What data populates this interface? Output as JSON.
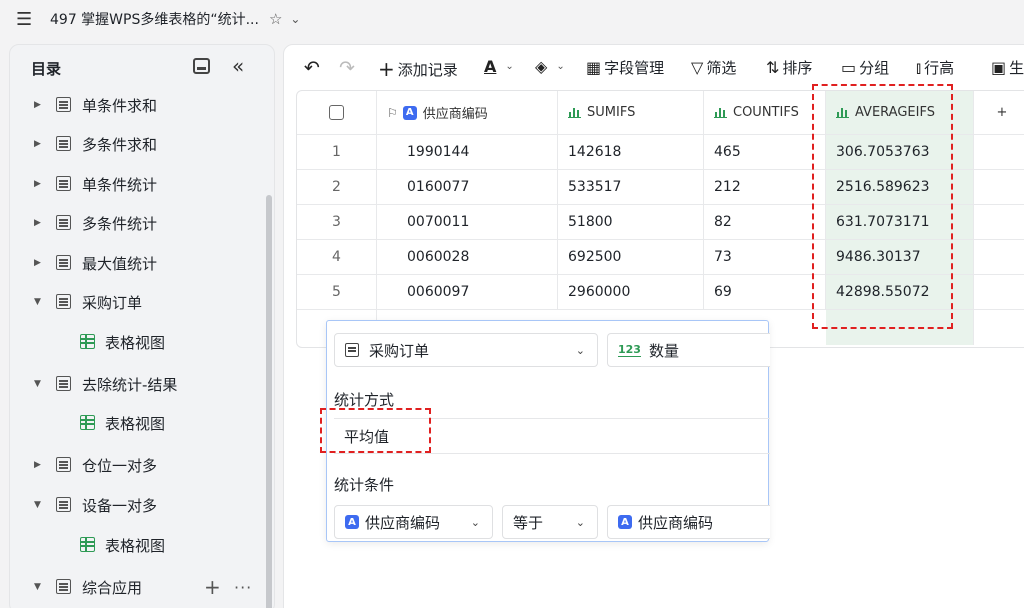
{
  "window": {
    "title": "497 掌握WPS多维表格的“统计...",
    "menu_icon": "hamburger-icon",
    "star_icon": "star-icon"
  },
  "sidebar": {
    "title": "目录",
    "items": [
      {
        "label": "单条件求和",
        "expanded": false
      },
      {
        "label": "多条件求和",
        "expanded": false
      },
      {
        "label": "单条件统计",
        "expanded": false
      },
      {
        "label": "多条件统计",
        "expanded": false
      },
      {
        "label": "最大值统计",
        "expanded": false
      },
      {
        "label": "采购订单",
        "expanded": true
      },
      {
        "label": "表格视图",
        "child": true
      },
      {
        "label": "去除统计-结果",
        "expanded": true
      },
      {
        "label": "表格视图",
        "child": true
      },
      {
        "label": "仓位一对多",
        "expanded": false
      },
      {
        "label": "设备一对多",
        "expanded": true
      },
      {
        "label": "表格视图",
        "child": true
      },
      {
        "label": "综合应用",
        "expanded": true
      }
    ]
  },
  "toolbar": {
    "undo": "undo-icon",
    "redo": "redo-icon",
    "add_record": "添加记录",
    "field_manage": "字段管理",
    "filter": "筛选",
    "sort": "排序",
    "group": "分组",
    "row_height": "行高",
    "last_partial": "生"
  },
  "table": {
    "headers": [
      "供应商编码",
      "SUMIFS",
      "COUNTIFS",
      "AVERAGEIFS"
    ],
    "rows": [
      {
        "n": "1",
        "code": "1990144",
        "sumifs": "142618",
        "countifs": "465",
        "averageifs": "306.7053763"
      },
      {
        "n": "2",
        "code": "0160077",
        "sumifs": "533517",
        "countifs": "212",
        "averageifs": "2516.589623"
      },
      {
        "n": "3",
        "code": "0070011",
        "sumifs": "51800",
        "countifs": "82",
        "averageifs": "631.7073171"
      },
      {
        "n": "4",
        "code": "0060028",
        "sumifs": "692500",
        "countifs": "73",
        "averageifs": "9486.30137"
      },
      {
        "n": "5",
        "code": "0060097",
        "sumifs": "2960000",
        "countifs": "69",
        "averageifs": "42898.55072"
      }
    ],
    "add_column": "+"
  },
  "popup": {
    "source_table": "采购订单",
    "source_field": "数量",
    "method_label": "统计方式",
    "method_value": "平均值",
    "condition_label": "统计条件",
    "cond_field": "供应商编码",
    "cond_op": "等于",
    "cond_value": "供应商编码"
  },
  "colors": {
    "highlight_dash": "#e02020",
    "accent_blue": "#3e6bf0",
    "accent_green": "#2e9a55",
    "highlight_column": "#e9f3ec"
  }
}
